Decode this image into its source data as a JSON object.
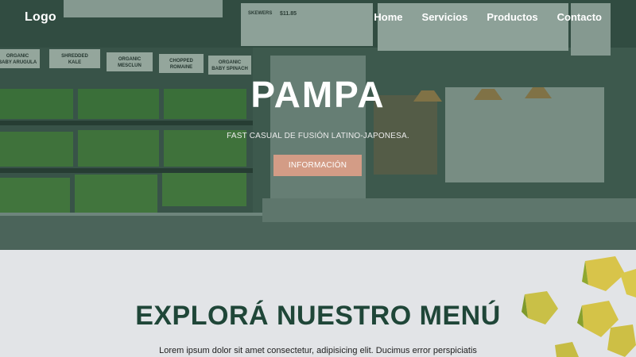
{
  "nav": {
    "logo": "Logo",
    "links": [
      "Home",
      "Servicios",
      "Productos",
      "Contacto"
    ]
  },
  "hero": {
    "title": "PAMPA",
    "subtitle": "FAST CASUAL DE FUSIÓN LATINO-JAPONESA.",
    "button_label": "INFORMACIÓN",
    "shelf_labels": [
      "ORGANIC BABY ARUGULA",
      "SHREDDED KALE",
      "ORGANIC MESCLUN",
      "CHOPPED ROMAINE",
      "ORGANIC BABY SPINACH"
    ],
    "menu_board_price": "$11.85"
  },
  "menu": {
    "title": "EXPLORÁ NUESTRO MENÚ",
    "text": "Lorem ipsum dolor sit amet consectetur, adipisicing elit. Ducimus error perspiciatis"
  },
  "colors": {
    "overlay": "#204a3a",
    "accent_button": "#d39c86",
    "heading": "#1f4638",
    "section_bg": "#e2e4e7"
  }
}
